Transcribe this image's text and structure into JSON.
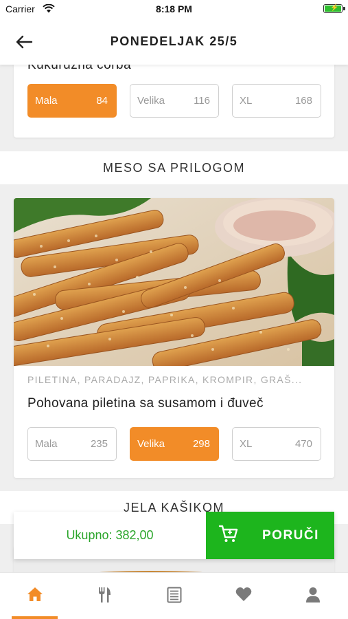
{
  "status_bar": {
    "carrier": "Carrier",
    "time": "8:18 PM"
  },
  "header": {
    "title": "PONEDELJAK 25/5",
    "back_icon": "arrow-left-icon"
  },
  "soup": {
    "name": "Kukuruzna corba",
    "sizes": [
      {
        "label": "Mala",
        "price": "84",
        "selected": true
      },
      {
        "label": "Velika",
        "price": "116",
        "selected": false
      },
      {
        "label": "XL",
        "price": "168",
        "selected": false
      }
    ]
  },
  "sections": {
    "meso": "MESO SA PRILOGOM",
    "kasikom": "JELA KAŠIKOM"
  },
  "dish": {
    "ingredients": "PILETINA, PARADAJZ, PAPRIKA, KROMPIR, GRAŠ...",
    "name": "Pohovana piletina sa susamom i đuveč",
    "sizes": [
      {
        "label": "Mala",
        "price": "235",
        "selected": false
      },
      {
        "label": "Velika",
        "price": "298",
        "selected": true
      },
      {
        "label": "XL",
        "price": "470",
        "selected": false
      }
    ]
  },
  "order": {
    "total": "Ukupno: 382,00",
    "button": "PORUČI",
    "icon": "add-to-cart-icon"
  },
  "tabs": [
    {
      "icon": "home-icon",
      "active": true
    },
    {
      "icon": "fork-knife-icon",
      "active": false
    },
    {
      "icon": "menu-list-icon",
      "active": false
    },
    {
      "icon": "heart-icon",
      "active": false
    },
    {
      "icon": "user-icon",
      "active": false
    }
  ],
  "colors": {
    "accent": "#f28c28",
    "order_green": "#1db51d",
    "total_green": "#2aa52a"
  }
}
